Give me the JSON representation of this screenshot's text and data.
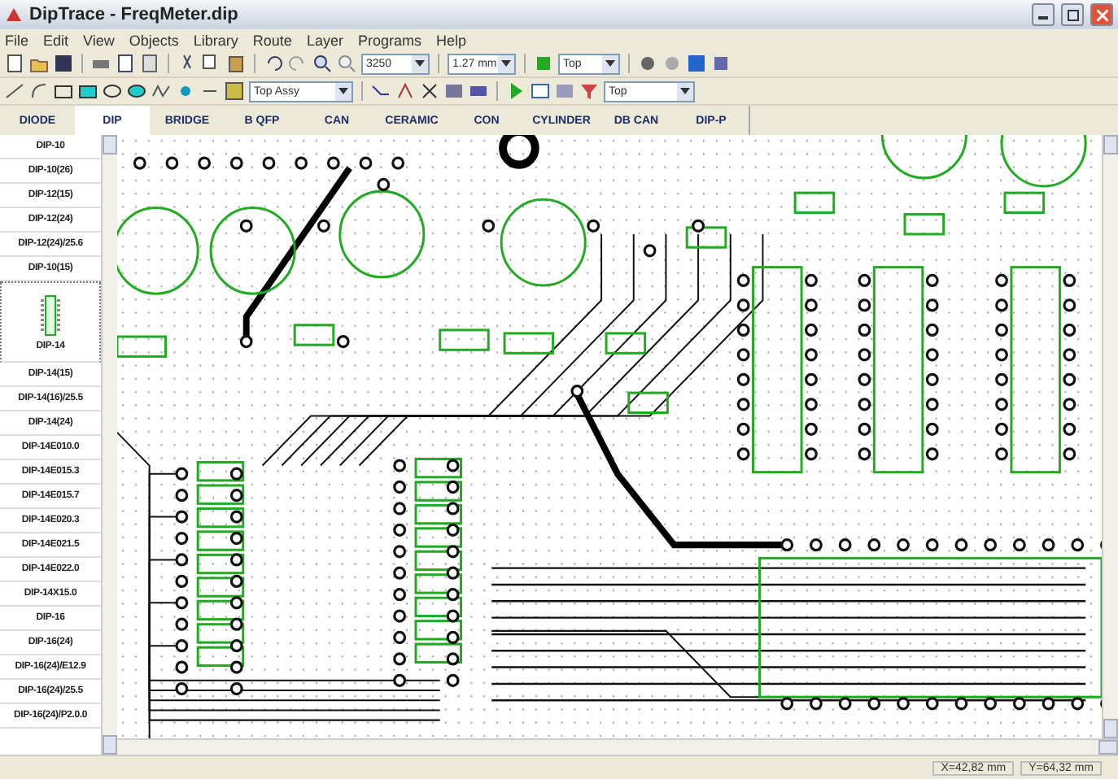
{
  "window": {
    "title": "DipTrace - FreqMeter.dip"
  },
  "menu": [
    "File",
    "Edit",
    "View",
    "Objects",
    "Library",
    "Route",
    "Layer",
    "Programs",
    "Help"
  ],
  "toolbar_1": {
    "zoom": "3250",
    "grid": "1.27 mm",
    "layer": "Top"
  },
  "toolbar_2": {
    "assembly": "Top Assy",
    "side": "Top"
  },
  "categories": [
    {
      "label": "DIODE",
      "selected": false
    },
    {
      "label": "DIP",
      "selected": true
    },
    {
      "label": "BRIDGE",
      "selected": false
    },
    {
      "label": "B QFP",
      "selected": false
    },
    {
      "label": "CAN",
      "selected": false
    },
    {
      "label": "CERAMIC",
      "selected": false
    },
    {
      "label": "CON",
      "selected": false
    },
    {
      "label": "CYLINDER",
      "selected": false
    },
    {
      "label": "DB CAN",
      "selected": false
    },
    {
      "label": "DIP-P",
      "selected": false
    }
  ],
  "patterns": [
    {
      "label": "DIP-10",
      "selected": false
    },
    {
      "label": "DIP-10(26)",
      "selected": false
    },
    {
      "label": "DIP-12(15)",
      "selected": false
    },
    {
      "label": "DIP-12(24)",
      "selected": false
    },
    {
      "label": "DIP-12(24)/25.6",
      "selected": false
    },
    {
      "label": "DIP-10(15)",
      "selected": false
    },
    {
      "label": "DIP-14",
      "selected": true
    },
    {
      "label": "DIP-14(15)",
      "selected": false
    },
    {
      "label": "DIP-14(16)/25.5",
      "selected": false
    },
    {
      "label": "DIP-14(24)",
      "selected": false
    },
    {
      "label": "DIP-14E010.0",
      "selected": false
    },
    {
      "label": "DIP-14E015.3",
      "selected": false
    },
    {
      "label": "DIP-14E015.7",
      "selected": false
    },
    {
      "label": "DIP-14E020.3",
      "selected": false
    },
    {
      "label": "DIP-14E021.5",
      "selected": false
    },
    {
      "label": "DIP-14E022.0",
      "selected": false
    },
    {
      "label": "DIP-14X15.0",
      "selected": false
    },
    {
      "label": "DIP-16",
      "selected": false
    },
    {
      "label": "DIP-16(24)",
      "selected": false
    },
    {
      "label": "DIP-16(24)/E12.9",
      "selected": false
    },
    {
      "label": "DIP-16(24)/25.5",
      "selected": false
    },
    {
      "label": "DIP-16(24)/P2.0.0",
      "selected": false
    }
  ],
  "status_bar": {
    "x": "X=42,82 mm",
    "y": "Y=64,32 mm"
  }
}
